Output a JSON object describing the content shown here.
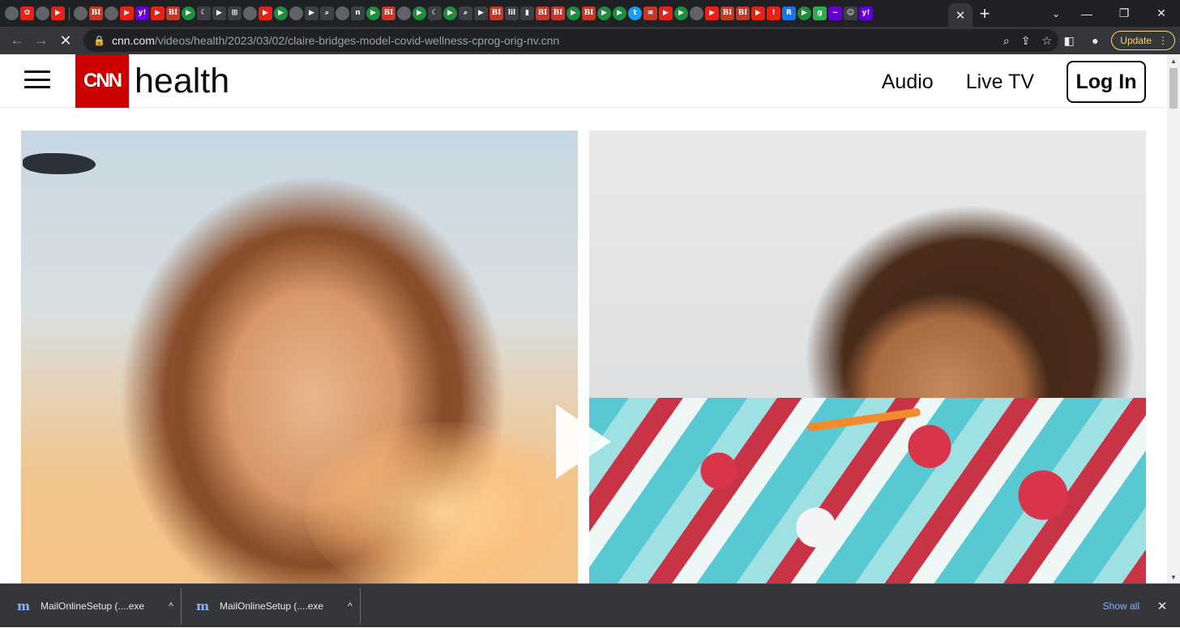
{
  "browser": {
    "tab_close_glyph": "✕",
    "new_tab_glyph": "+",
    "tab_search_glyph": "⌄",
    "window_controls": {
      "minimize": "—",
      "restore": "❐",
      "close": "✕"
    },
    "favicons": [
      {
        "kind": "globe",
        "text": ""
      },
      {
        "kind": "yt",
        "text": "✿"
      },
      {
        "kind": "globe",
        "text": ""
      },
      {
        "kind": "yt",
        "text": "▶"
      },
      {
        "kind": "sep"
      },
      {
        "kind": "globe",
        "text": ""
      },
      {
        "kind": "bi",
        "text": "BI"
      },
      {
        "kind": "globe",
        "text": ""
      },
      {
        "kind": "yt",
        "text": "▶"
      },
      {
        "kind": "yh",
        "text": "y!"
      },
      {
        "kind": "yt",
        "text": "▶"
      },
      {
        "kind": "bi",
        "text": "BI"
      },
      {
        "kind": "play",
        "text": "▶"
      },
      {
        "kind": "dark",
        "text": "☾"
      },
      {
        "kind": "dark",
        "text": "▶"
      },
      {
        "kind": "dark",
        "text": "⊞"
      },
      {
        "kind": "globe",
        "text": ""
      },
      {
        "kind": "yt",
        "text": "▶"
      },
      {
        "kind": "play",
        "text": "▶"
      },
      {
        "kind": "globe",
        "text": ""
      },
      {
        "kind": "dark",
        "text": "▶"
      },
      {
        "kind": "dark",
        "text": "⌕"
      },
      {
        "kind": "globe",
        "text": ""
      },
      {
        "kind": "dark",
        "text": "n"
      },
      {
        "kind": "play",
        "text": "▶"
      },
      {
        "kind": "bi",
        "text": "BI"
      },
      {
        "kind": "globe",
        "text": ""
      },
      {
        "kind": "play",
        "text": "▶"
      },
      {
        "kind": "dark",
        "text": "☾"
      },
      {
        "kind": "play",
        "text": "▶"
      },
      {
        "kind": "dark",
        "text": "⌕"
      },
      {
        "kind": "dark",
        "text": "▶"
      },
      {
        "kind": "bi",
        "text": "BI"
      },
      {
        "kind": "dark",
        "text": "lil"
      },
      {
        "kind": "dark",
        "text": "▮"
      },
      {
        "kind": "bi",
        "text": "BI"
      },
      {
        "kind": "bi",
        "text": "BI"
      },
      {
        "kind": "play",
        "text": "▶"
      },
      {
        "kind": "bi",
        "text": "BI"
      },
      {
        "kind": "play",
        "text": "▶"
      },
      {
        "kind": "play",
        "text": "▶"
      },
      {
        "kind": "tw",
        "text": "t"
      },
      {
        "kind": "bi",
        "text": "≡"
      },
      {
        "kind": "yt",
        "text": "▶"
      },
      {
        "kind": "play",
        "text": "▶"
      },
      {
        "kind": "globe",
        "text": ""
      },
      {
        "kind": "yt",
        "text": "▶"
      },
      {
        "kind": "bi",
        "text": "BI"
      },
      {
        "kind": "bi",
        "text": "BI"
      },
      {
        "kind": "yt",
        "text": "▶"
      },
      {
        "kind": "yt",
        "text": "!"
      },
      {
        "kind": "blue",
        "text": "R"
      },
      {
        "kind": "play",
        "text": "▶"
      },
      {
        "kind": "gr",
        "text": "g"
      },
      {
        "kind": "yh",
        "text": "~"
      },
      {
        "kind": "dark",
        "text": "☺"
      },
      {
        "kind": "yh",
        "text": "y!"
      }
    ],
    "nav": {
      "back": "←",
      "forward": "→",
      "stop": "✕"
    },
    "url_host": "cnn.com",
    "url_path": "/videos/health/2023/03/02/claire-bridges-model-covid-wellness-cprog-orig-nv.cnn",
    "omnibox_icons": {
      "zoom": "⌕",
      "share": "⇪",
      "bookmark": "☆"
    },
    "toolbar_icons": {
      "sidepanel": "◧",
      "profile": "●"
    },
    "update_label": "Update",
    "menu_glyph": "⋮"
  },
  "site": {
    "logo_text": "CNN",
    "section": "health",
    "nav_links": [
      "Audio",
      "Live TV"
    ],
    "login_label": "Log In"
  },
  "downloads": {
    "items": [
      {
        "name": "MailOnlineSetup (....exe",
        "icon": "m"
      },
      {
        "name": "MailOnlineSetup (....exe",
        "icon": "m"
      }
    ],
    "caret": "^",
    "show_all": "Show all",
    "close": "✕"
  },
  "scrollbar": {
    "up": "▲",
    "down": "▼"
  }
}
